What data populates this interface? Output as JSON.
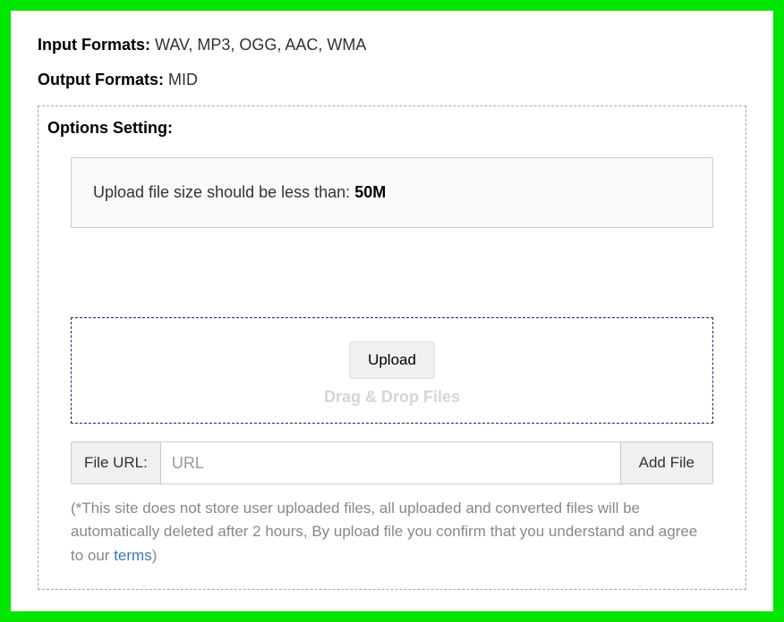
{
  "formats": {
    "input_label": "Input Formats:",
    "input_value": " WAV, MP3, OGG, AAC, WMA",
    "output_label": "Output Formats:",
    "output_value": " MID"
  },
  "options": {
    "title": "Options Setting:",
    "notice_prefix": "Upload file size should be less than: ",
    "notice_limit": "50M"
  },
  "upload": {
    "button_label": "Upload",
    "drag_text": "Drag & Drop Files"
  },
  "url_row": {
    "label": "File URL:",
    "placeholder": "URL",
    "value": "",
    "add_button": "Add File"
  },
  "disclaimer": {
    "text_before": "(*This site does not store user uploaded files, all uploaded and converted files will be automatically deleted after 2 hours, By upload file you confirm that you understand and agree to our ",
    "link_text": "terms",
    "text_after": ")"
  }
}
